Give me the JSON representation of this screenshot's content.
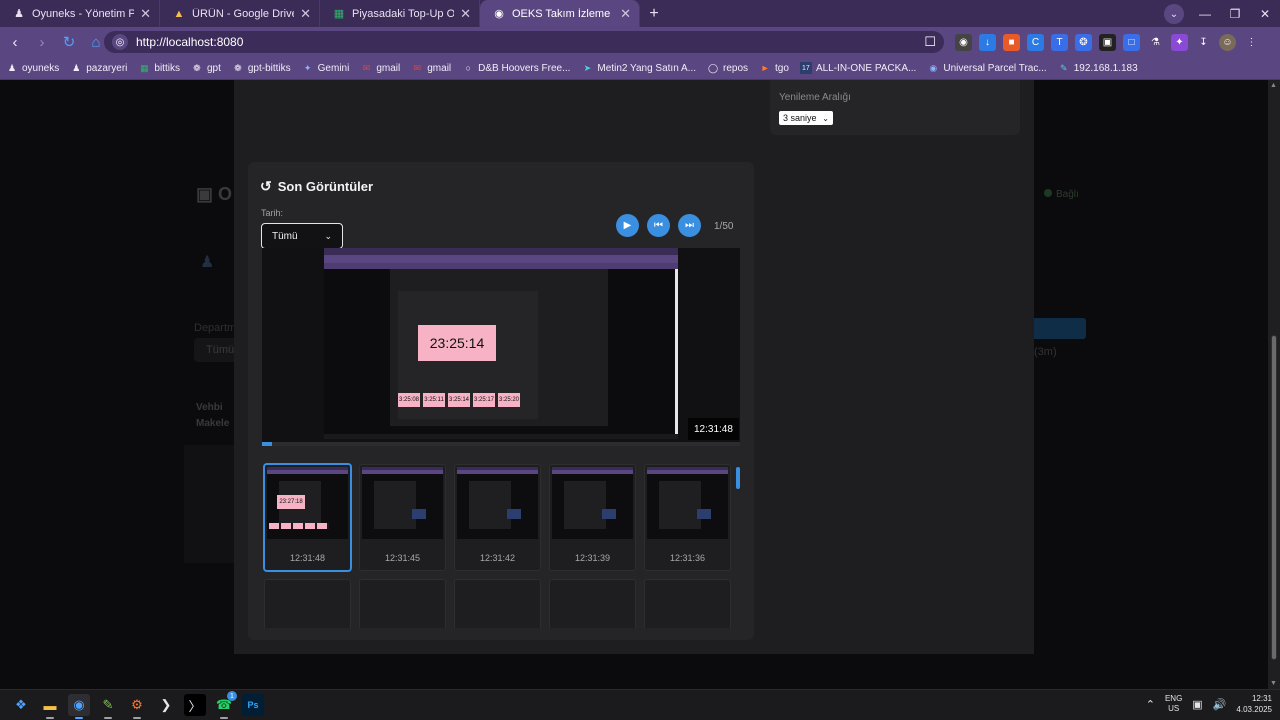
{
  "browser": {
    "tabs": [
      {
        "title": "Oyuneks - Yönetim Paneli",
        "icon": "person-icon",
        "active": false
      },
      {
        "title": "ÜRÜN - Google Drive",
        "icon": "drive-icon",
        "active": false
      },
      {
        "title": "Piyasadaki Top-Up Oyunlar ID ",
        "icon": "sheets-icon",
        "active": false
      },
      {
        "title": "OEKS Takım İzleme Paneli",
        "icon": "globe-icon",
        "active": true
      }
    ],
    "url": "http://localhost:8080",
    "bookmarks": [
      {
        "label": "oyuneks",
        "icon": "person-icon"
      },
      {
        "label": "pazaryeri",
        "icon": "person-icon"
      },
      {
        "label": "bittiks",
        "icon": "sheets-icon"
      },
      {
        "label": "gpt",
        "icon": "openai-icon"
      },
      {
        "label": "gpt-bittiks",
        "icon": "openai-icon"
      },
      {
        "label": "Gemini",
        "icon": "gemini-icon"
      },
      {
        "label": "gmail",
        "icon": "gmail-icon"
      },
      {
        "label": "gmail",
        "icon": "gmail-icon"
      },
      {
        "label": "D&B Hoovers Free...",
        "icon": "link-icon"
      },
      {
        "label": "Metin2 Yang Satın A...",
        "icon": "arrow-icon"
      },
      {
        "label": "repos",
        "icon": "github-icon"
      },
      {
        "label": "tgo",
        "icon": "tgo-icon"
      },
      {
        "label": "ALL-IN-ONE PACKA...",
        "icon": "number-icon"
      },
      {
        "label": "Universal Parcel Trac...",
        "icon": "parcel-icon"
      },
      {
        "label": "192.168.1.183",
        "icon": "pen-icon"
      }
    ]
  },
  "settings": {
    "refresh_label": "Yenileme Aralığı",
    "refresh_value": "3 saniye"
  },
  "background": {
    "title": "O",
    "connection": "Bağlı",
    "filter_label": "Departman",
    "filter_value": "Tümü",
    "name": "Vehbi",
    "name2": "Makele",
    "interval": "(3m)"
  },
  "recent": {
    "title": "Son Görüntüler",
    "filter_label": "Tarih:",
    "filter_value": "Tümü",
    "counter": "1/50",
    "current_time": "12:31:48",
    "progress": 0.02,
    "preview_clock": "23:25:14",
    "preview_thumbs": [
      "3:25:08",
      "3:25:11",
      "3:25:14",
      "3:25:17",
      "3:25:20"
    ],
    "thumbnails": [
      {
        "time": "12:31:48",
        "selected": true,
        "clock": "23:27:18"
      },
      {
        "time": "12:31:45",
        "selected": false
      },
      {
        "time": "12:31:42",
        "selected": false
      },
      {
        "time": "12:31:39",
        "selected": false
      },
      {
        "time": "12:31:36",
        "selected": false
      },
      {
        "time": "",
        "selected": false
      },
      {
        "time": "",
        "selected": false
      },
      {
        "time": "",
        "selected": false
      },
      {
        "time": "",
        "selected": false
      },
      {
        "time": "",
        "selected": false
      }
    ]
  },
  "taskbar": {
    "lang_top": "ENG",
    "lang_bottom": "US",
    "time": "12:31",
    "date": "4.03.2025",
    "whatsapp_badge": "1"
  },
  "colors": {
    "accent": "#3a8fe0",
    "chrome": "#5a4680",
    "card": "#252527",
    "pink": "#f7b3c5"
  }
}
